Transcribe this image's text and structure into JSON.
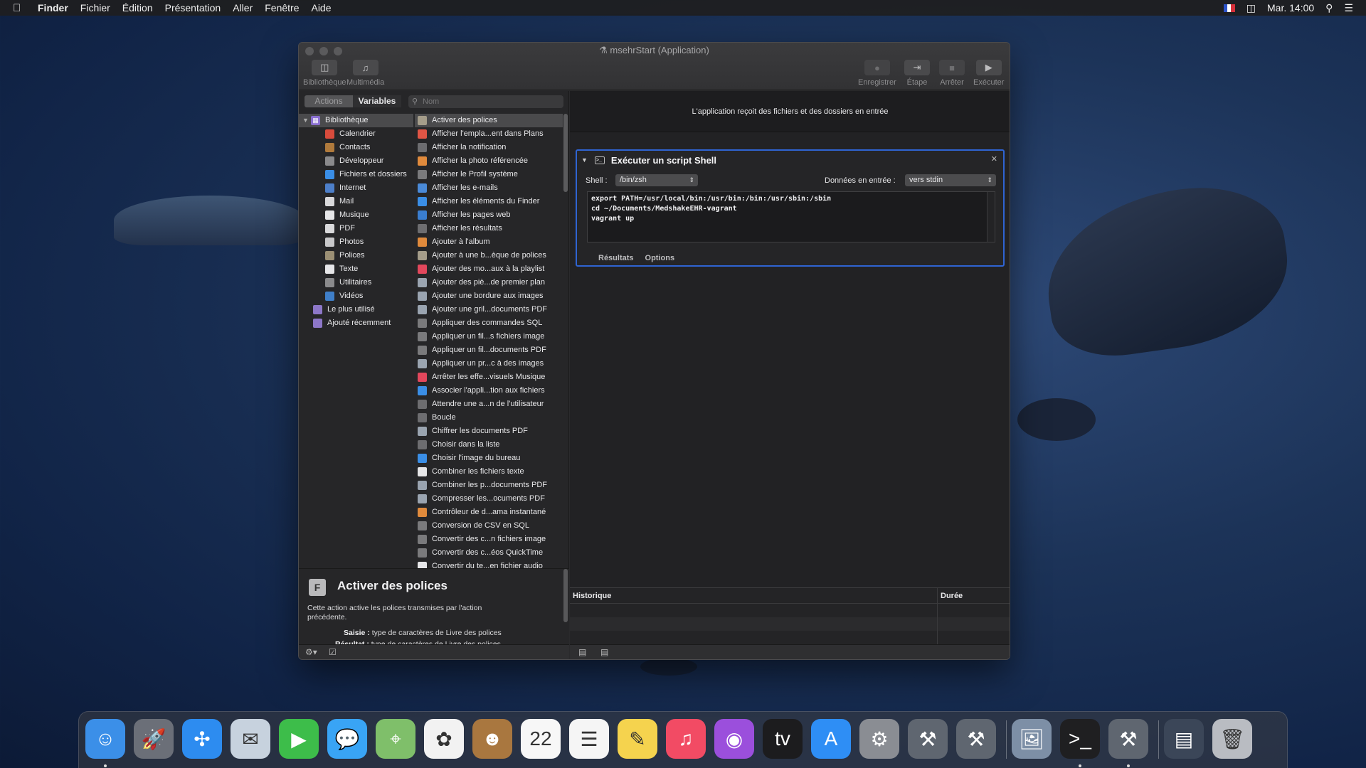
{
  "menubar": {
    "apple": "",
    "items": [
      "Finder",
      "Fichier",
      "Édition",
      "Présentation",
      "Aller",
      "Fenêtre",
      "Aide"
    ],
    "clock": "Mar. 14:00"
  },
  "window": {
    "title": "msehrStart (Application)",
    "toolbar_left": [
      {
        "label": "Bibliothèque",
        "icon": "sidebar-icon"
      },
      {
        "label": "Multimédia",
        "icon": "media-icon"
      }
    ],
    "toolbar_right": [
      {
        "label": "Enregistrer",
        "icon": "record-icon"
      },
      {
        "label": "Étape",
        "icon": "step-icon"
      },
      {
        "label": "Arrêter",
        "icon": "stop-icon"
      },
      {
        "label": "Exécuter",
        "icon": "play-icon"
      }
    ]
  },
  "library": {
    "tabs": [
      "Actions",
      "Variables"
    ],
    "search_placeholder": "Nom",
    "root": "Bibliothèque",
    "categories": [
      {
        "label": "Calendrier",
        "icon": "calendar-icon",
        "color": "#d84b3c"
      },
      {
        "label": "Contacts",
        "icon": "contacts-icon",
        "color": "#b07a3c"
      },
      {
        "label": "Développeur",
        "icon": "tools-icon",
        "color": "#8a8a8c"
      },
      {
        "label": "Fichiers et dossiers",
        "icon": "finder-icon",
        "color": "#3a8ee6"
      },
      {
        "label": "Internet",
        "icon": "globe-icon",
        "color": "#4d7fc9"
      },
      {
        "label": "Mail",
        "icon": "mail-icon",
        "color": "#d9d9db"
      },
      {
        "label": "Musique",
        "icon": "music-icon",
        "color": "#e6e6e8"
      },
      {
        "label": "PDF",
        "icon": "pdf-icon",
        "color": "#d9d9db"
      },
      {
        "label": "Photos",
        "icon": "photos-icon",
        "color": "#c8c8ca"
      },
      {
        "label": "Polices",
        "icon": "fonts-icon",
        "color": "#9b8f74"
      },
      {
        "label": "Texte",
        "icon": "text-icon",
        "color": "#e6e6e8"
      },
      {
        "label": "Utilitaires",
        "icon": "tools-icon",
        "color": "#8a8a8c"
      },
      {
        "label": "Vidéos",
        "icon": "video-icon",
        "color": "#3f7fc9"
      }
    ],
    "extra": [
      {
        "label": "Le plus utilisé",
        "icon": "folder-icon",
        "color": "#8d77c8"
      },
      {
        "label": "Ajouté récemment",
        "icon": "folder-icon",
        "color": "#8d77c8"
      }
    ]
  },
  "actions": [
    {
      "label": "Activer des polices",
      "icon": "fonts-icon",
      "color": "#a59d8a"
    },
    {
      "label": "Afficher l'empla...ent dans Plans",
      "icon": "maps-icon",
      "color": "#e05545"
    },
    {
      "label": "Afficher la notification",
      "icon": "automator-icon",
      "color": "#6d6d70"
    },
    {
      "label": "Afficher la photo référencée",
      "icon": "photos-icon",
      "color": "#e08a3c"
    },
    {
      "label": "Afficher le Profil système",
      "icon": "tools-icon",
      "color": "#7a7a7c"
    },
    {
      "label": "Afficher les e-mails",
      "icon": "mail-icon",
      "color": "#4a8ad8"
    },
    {
      "label": "Afficher les éléments du Finder",
      "icon": "finder-icon",
      "color": "#3a8ee6"
    },
    {
      "label": "Afficher les pages web",
      "icon": "globe-icon",
      "color": "#3a7ed0"
    },
    {
      "label": "Afficher les résultats",
      "icon": "automator-icon",
      "color": "#6d6d70"
    },
    {
      "label": "Ajouter à l'album",
      "icon": "photos-icon",
      "color": "#e08a3c"
    },
    {
      "label": "Ajouter à une b...èque de polices",
      "icon": "fonts-icon",
      "color": "#a59d8a"
    },
    {
      "label": "Ajouter des mo...aux à la playlist",
      "icon": "music-icon",
      "color": "#e2475c"
    },
    {
      "label": "Ajouter des piè...de premier plan",
      "icon": "preview-icon",
      "color": "#9aa4b0"
    },
    {
      "label": "Ajouter une bordure aux images",
      "icon": "preview-icon",
      "color": "#9aa4b0"
    },
    {
      "label": "Ajouter une gril...documents PDF",
      "icon": "preview-icon",
      "color": "#9aa4b0"
    },
    {
      "label": "Appliquer des commandes SQL",
      "icon": "tools-icon",
      "color": "#7a7a7c"
    },
    {
      "label": "Appliquer un fil...s fichiers image",
      "icon": "tools-icon",
      "color": "#7a7a7c"
    },
    {
      "label": "Appliquer un fil...documents PDF",
      "icon": "tools-icon",
      "color": "#7a7a7c"
    },
    {
      "label": "Appliquer un pr...c à des images",
      "icon": "preview-icon",
      "color": "#9aa4b0"
    },
    {
      "label": "Arrêter les effe...visuels Musique",
      "icon": "music-icon",
      "color": "#e2475c"
    },
    {
      "label": "Associer l'appli...tion aux fichiers",
      "icon": "finder-icon",
      "color": "#3a8ee6"
    },
    {
      "label": "Attendre une a...n de l'utilisateur",
      "icon": "automator-icon",
      "color": "#6d6d70"
    },
    {
      "label": "Boucle",
      "icon": "automator-icon",
      "color": "#6d6d70"
    },
    {
      "label": "Chiffrer les documents PDF",
      "icon": "preview-icon",
      "color": "#9aa4b0"
    },
    {
      "label": "Choisir dans la liste",
      "icon": "automator-icon",
      "color": "#6d6d70"
    },
    {
      "label": "Choisir l'image du bureau",
      "icon": "finder-icon",
      "color": "#3a8ee6"
    },
    {
      "label": "Combiner les fichiers texte",
      "icon": "text-icon",
      "color": "#e6e6e8"
    },
    {
      "label": "Combiner les p...documents PDF",
      "icon": "preview-icon",
      "color": "#9aa4b0"
    },
    {
      "label": "Compresser les...ocuments PDF",
      "icon": "preview-icon",
      "color": "#9aa4b0"
    },
    {
      "label": "Contrôleur de d...ama instantané",
      "icon": "photos-icon",
      "color": "#e08a3c"
    },
    {
      "label": "Conversion de CSV en SQL",
      "icon": "tools-icon",
      "color": "#7a7a7c"
    },
    {
      "label": "Convertir des c...n fichiers image",
      "icon": "tools-icon",
      "color": "#7a7a7c"
    },
    {
      "label": "Convertir des c...éos QuickTime",
      "icon": "tools-icon",
      "color": "#7a7a7c"
    },
    {
      "label": "Convertir du te...en fichier audio",
      "icon": "text-icon",
      "color": "#e6e6e8"
    }
  ],
  "description": {
    "title": "Activer des polices",
    "text": "Cette action active les polices transmises par l'action précédente.",
    "input_label": "Saisie :",
    "input_value": "type de caractères de Livre des polices",
    "output_label": "Résultat :",
    "output_value": "type de caractères de Livre des polices"
  },
  "workflow": {
    "input_header": "L'application reçoit des fichiers et des dossiers en entrée",
    "action_title": "Exécuter un script Shell",
    "shell_label": "Shell :",
    "shell_value": "/bin/zsh",
    "input_label": "Données en entrée :",
    "input_value": "vers stdin",
    "script": "export PATH=/usr/local/bin:/usr/bin:/bin:/usr/sbin:/sbin\ncd ~/Documents/MedshakeEHR-vagrant\nvagrant up",
    "tabs": [
      "Résultats",
      "Options"
    ]
  },
  "history": {
    "col_history": "Historique",
    "col_duration": "Durée"
  },
  "dock": {
    "apps": [
      {
        "name": "finder-icon",
        "color": "#3b8fe8",
        "glyph": "☺",
        "running": true
      },
      {
        "name": "launchpad-icon",
        "color": "#6b6f78",
        "glyph": "🚀",
        "running": false
      },
      {
        "name": "safari-icon",
        "color": "#2d8cf0",
        "glyph": "✣",
        "running": false
      },
      {
        "name": "mail-icon",
        "color": "#c7d2de",
        "glyph": "✉",
        "running": false
      },
      {
        "name": "facetime-icon",
        "color": "#3dbd4a",
        "glyph": "▶",
        "running": false
      },
      {
        "name": "messages-icon",
        "color": "#39a4f5",
        "glyph": "💬",
        "running": false
      },
      {
        "name": "maps-icon",
        "color": "#7fbf6a",
        "glyph": "⌖",
        "running": false
      },
      {
        "name": "photos-icon",
        "color": "#f2f2f2",
        "glyph": "✿",
        "running": false
      },
      {
        "name": "contacts-icon",
        "color": "#a9773f",
        "glyph": "☻",
        "running": false
      },
      {
        "name": "calendar-icon",
        "color": "#f7f7f7",
        "glyph": "22",
        "running": false
      },
      {
        "name": "reminders-icon",
        "color": "#f5f5f5",
        "glyph": "☰",
        "running": false
      },
      {
        "name": "notes-icon",
        "color": "#f5d34e",
        "glyph": "✎",
        "running": false
      },
      {
        "name": "music-icon",
        "color": "#f24b64",
        "glyph": "♫",
        "running": false
      },
      {
        "name": "podcasts-icon",
        "color": "#9b4fdc",
        "glyph": "◉",
        "running": false
      },
      {
        "name": "tv-icon",
        "color": "#1c1c1e",
        "glyph": "tv",
        "running": false
      },
      {
        "name": "app-store-icon",
        "color": "#2e8ef5",
        "glyph": "A",
        "running": false
      },
      {
        "name": "system-preferences-icon",
        "color": "#8a8d93",
        "glyph": "⚙",
        "running": false
      },
      {
        "name": "automator-icon",
        "color": "#5f6670",
        "glyph": "⚒",
        "running": false
      },
      {
        "name": "automator-icon",
        "color": "#5f6670",
        "glyph": "⚒",
        "running": false
      }
    ],
    "recent": [
      {
        "name": "preview-icon",
        "color": "#7d8fa6",
        "glyph": "🖼",
        "running": false
      },
      {
        "name": "terminal-icon",
        "color": "#1f1f21",
        "glyph": ">_",
        "running": true
      },
      {
        "name": "automator-icon",
        "color": "#5f6670",
        "glyph": "⚒",
        "running": true
      }
    ],
    "other": [
      {
        "name": "screenshot-folder-icon",
        "color": "#3b4658",
        "glyph": "▤",
        "running": false
      },
      {
        "name": "trash-icon",
        "color": "#b9bcc2",
        "glyph": "🗑",
        "running": false
      }
    ]
  }
}
